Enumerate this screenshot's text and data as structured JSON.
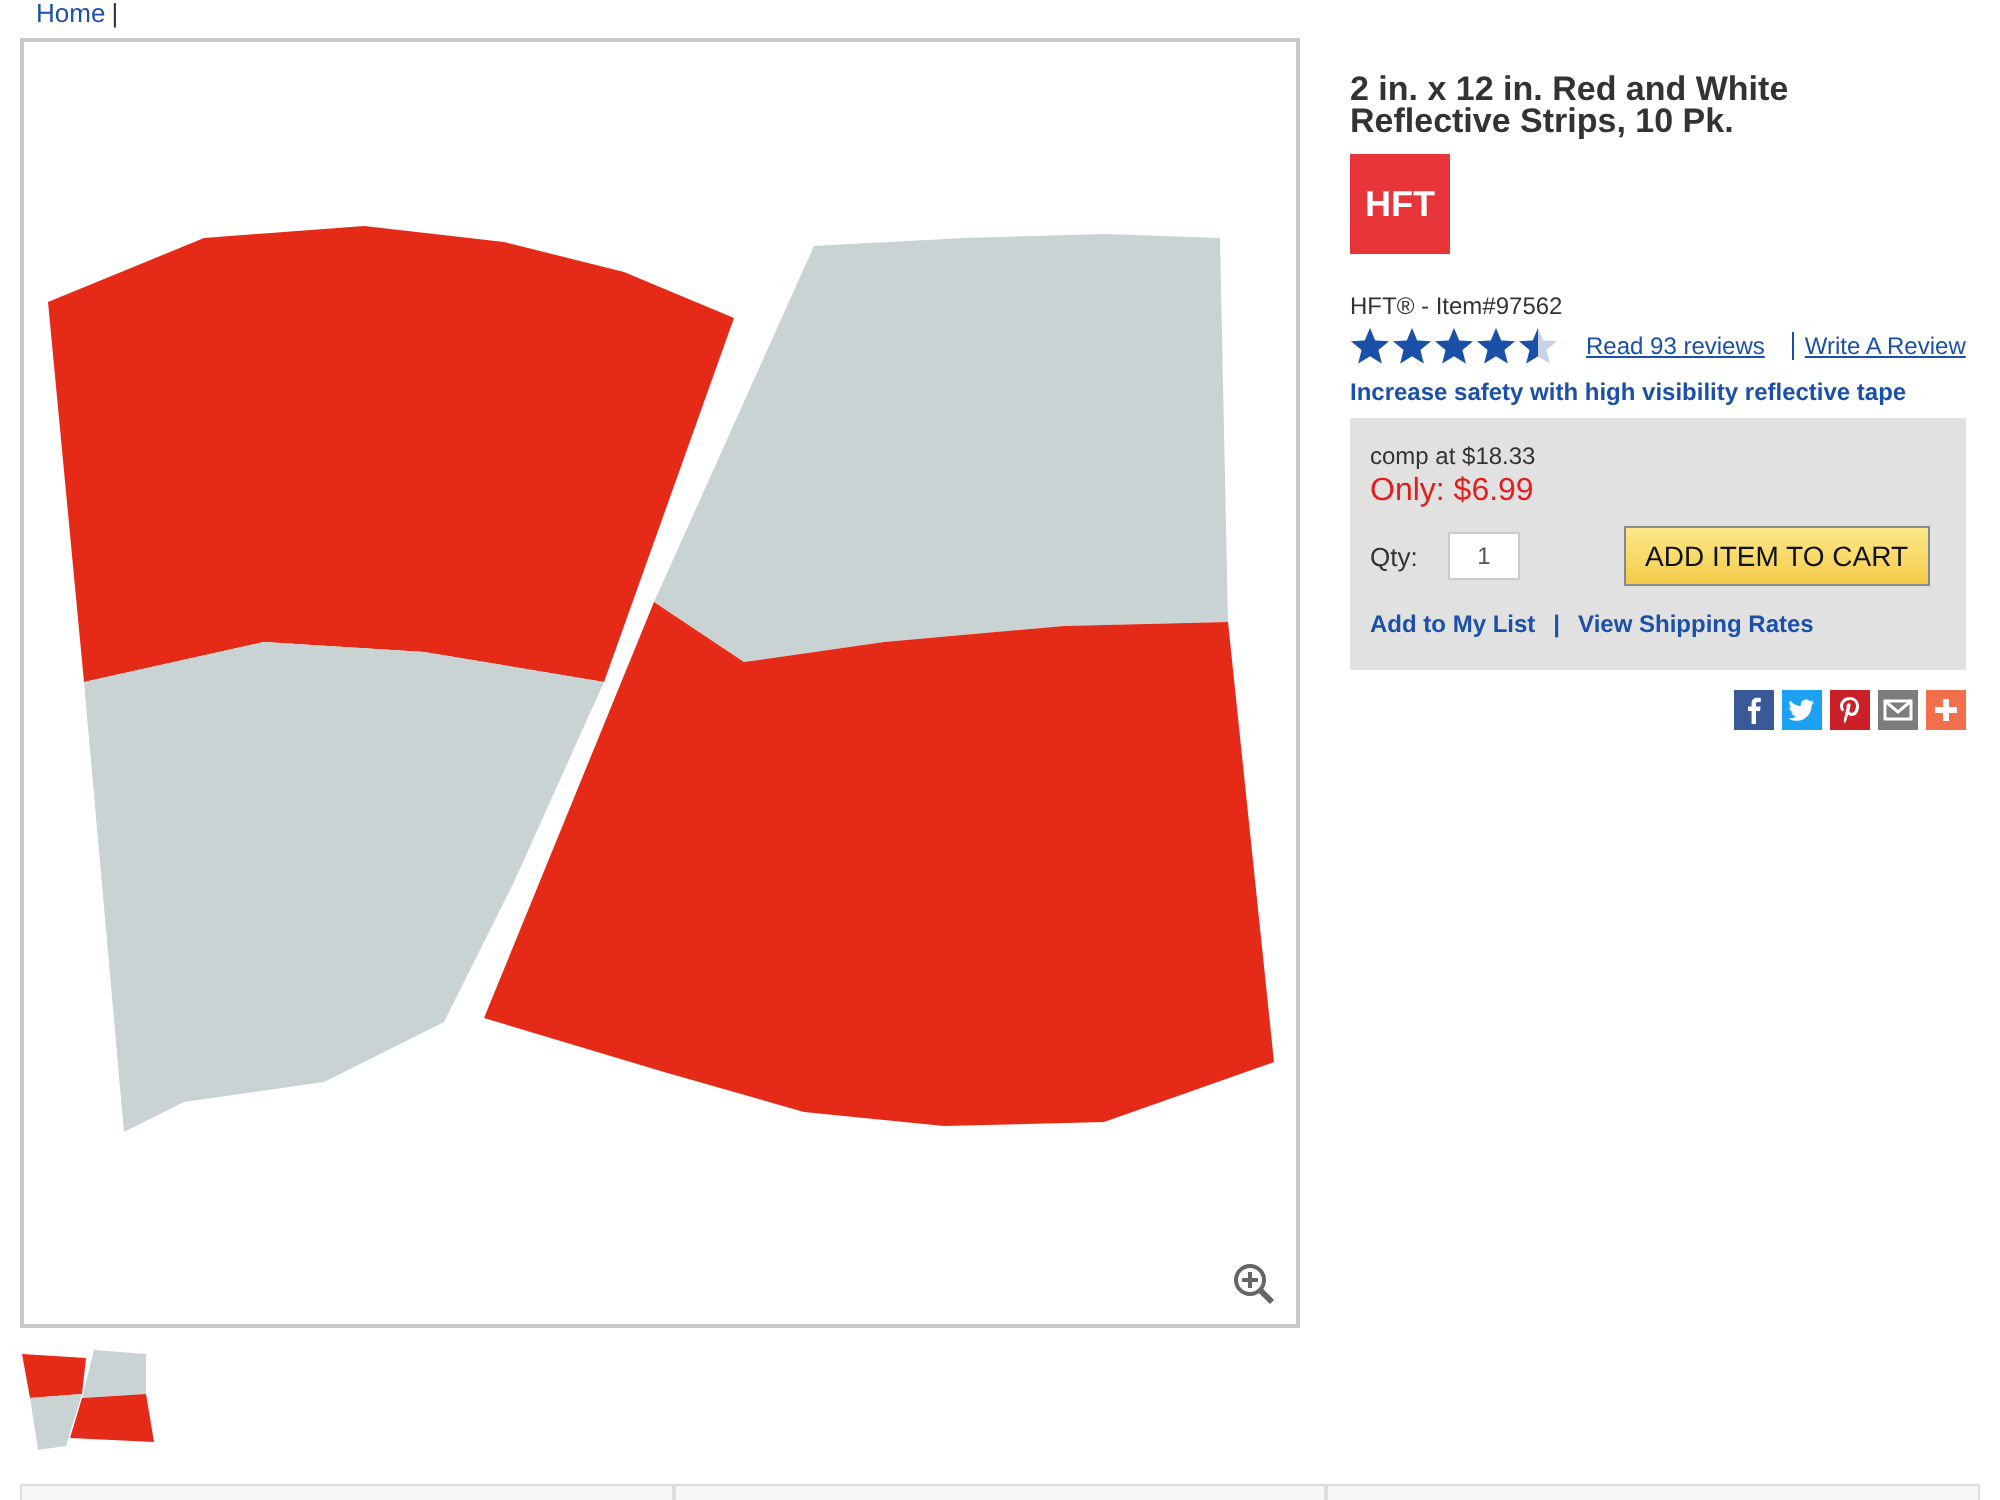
{
  "breadcrumb": {
    "link": "Home",
    "separator": "|"
  },
  "product": {
    "title": "2 in. x 12 in. Red and White Reflective Strips, 10 Pk.",
    "brand_item": "HFT® - Item#97562",
    "stars": 4.5,
    "reviews_link": "Read 93 reviews",
    "write_review_link": "Write A Review",
    "tagline": "Increase safety with high visibility reflective tape"
  },
  "logo": {
    "text": "HFT"
  },
  "price_box": {
    "comp": "comp at $18.33",
    "price": "Only: $6.99",
    "qty_label": "Qty:",
    "qty_value": "1",
    "add_button": "ADD ITEM TO CART",
    "add_to_list": "Add to My List",
    "separator": "|",
    "shipping_link": "View Shipping Rates"
  },
  "share": [
    {
      "kind": "facebook",
      "color": "#3b5998"
    },
    {
      "kind": "twitter",
      "color": "#1da1f2"
    },
    {
      "kind": "pinterest",
      "color": "#cb2027"
    },
    {
      "kind": "email",
      "color": "#7d7d7d"
    },
    {
      "kind": "more",
      "color": "#f26f4b"
    }
  ],
  "thumbnails": [
    {
      "selected": false
    }
  ]
}
